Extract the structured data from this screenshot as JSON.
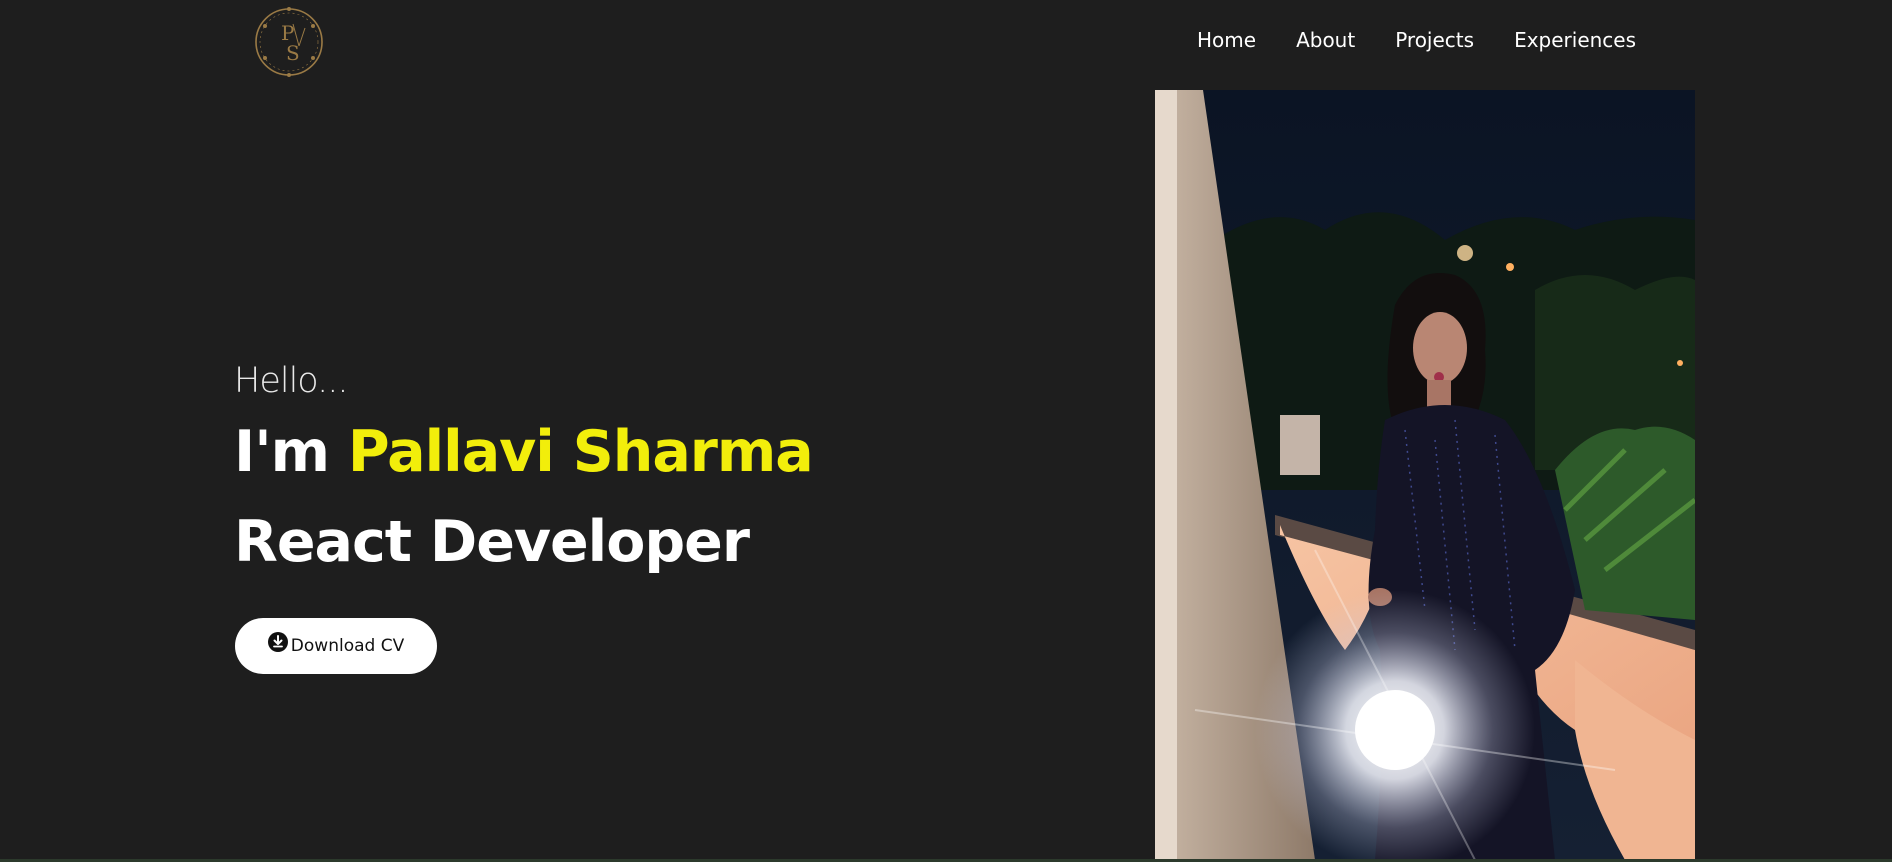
{
  "header": {
    "logo": {
      "icon": "ps-monogram-logo",
      "letters": "PS",
      "color": "#9a7a45"
    },
    "nav": [
      {
        "label": "Home"
      },
      {
        "label": "About"
      },
      {
        "label": "Projects"
      },
      {
        "label": "Experiences"
      }
    ]
  },
  "hero": {
    "greeting": "Hello...",
    "intro_prefix": "I'm ",
    "name": "Pallavi Sharma",
    "role": "React Developer",
    "download_button": {
      "label": "Download CV",
      "icon": "download-circle-icon"
    },
    "photo": {
      "icon": "profile-photo"
    }
  },
  "colors": {
    "background": "#1e1e1e",
    "accent": "#f2ee0b",
    "text": "#ffffff",
    "button_bg": "#ffffff"
  }
}
